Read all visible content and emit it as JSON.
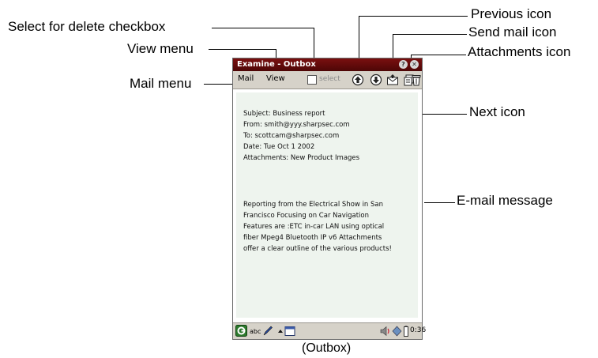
{
  "callouts": {
    "select_checkbox": "Select for delete checkbox",
    "view_menu": "View menu",
    "mail_menu": "Mail menu",
    "previous_icon": "Previous icon",
    "send_mail_icon": "Send mail icon",
    "attachments_icon": "Attachments icon",
    "next_icon": "Next icon",
    "email_message": "E-mail message"
  },
  "window": {
    "title": "Examine - Outbox",
    "help_glyph": "?",
    "close_glyph": "✕"
  },
  "toolbar": {
    "mail_label": "Mail",
    "view_label": "View",
    "select_label": "select",
    "icons": [
      "previous-icon",
      "next-icon",
      "send-mail-icon",
      "attachments-icon",
      "trash-icon"
    ]
  },
  "message": {
    "header_lines": [
      "Subject: Business report",
      "From:  smith@yyy.sharpsec.com",
      "To: scottcam@sharpsec.com",
      "Date: Tue Oct 1 2002",
      "Attachments: New Product Images"
    ],
    "body_lines": [
      "Reporting from the Electrical Show in San",
      "Francisco Focusing on Car Navigation",
      "Features are :ETC in-car LAN using optical",
      "fiber Mpeg4 Bluetooth IP v6 Attachments",
      "offer a clear outline of the various products!"
    ]
  },
  "statusbar": {
    "input_mode": "abc",
    "time": "0:36"
  },
  "caption": "(Outbox)",
  "colors": {
    "titlebar": "#6b0d0d",
    "toolbar": "#d6d2c9",
    "body": "#eef4ee"
  }
}
